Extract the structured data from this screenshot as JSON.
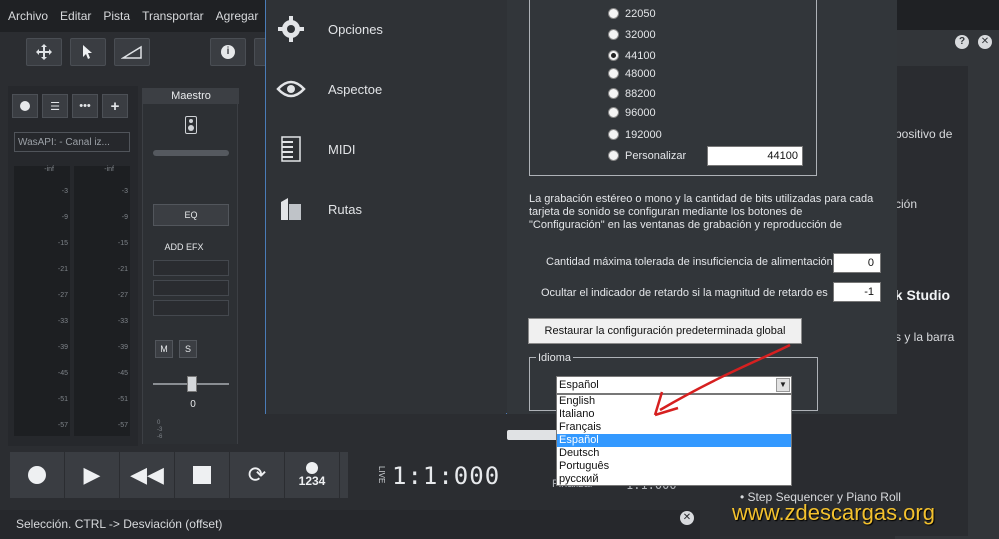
{
  "menubar": {
    "items": [
      "Archivo",
      "Editar",
      "Pista",
      "Transportar",
      "Agregar"
    ]
  },
  "toolbar": {
    "icons": [
      "move-icon",
      "pointer-icon",
      "envelope-icon",
      "info-icon"
    ]
  },
  "tracks": {
    "device": "WasAPI:  - Canal iz...",
    "meter_inf": "-inf",
    "ticks": [
      "-3",
      "-9",
      "-15",
      "-21",
      "-27",
      "-33",
      "-39",
      "-45",
      "-51",
      "-57"
    ]
  },
  "master": {
    "title": "Maestro",
    "eq_label": "EQ",
    "add_fx": "ADD EFX",
    "mute": "M",
    "solo": "S",
    "fader_value": "0",
    "mini_ticks": [
      "0",
      "-3",
      "-6"
    ]
  },
  "transport": {
    "live_label": "LIVE",
    "timecode": "1:1:000",
    "count_in": "1234",
    "finalizar_label": "Finalizar",
    "finalizar_value": "1:1:000"
  },
  "status": {
    "text": "Selección. CTRL -> Desviación (offset)"
  },
  "right_panel": {
    "line1": "positivo de",
    "line2": "ción",
    "heading": "ck Studio",
    "line3": "s y la barra",
    "bullet": "Step Sequencer y Piano Roll"
  },
  "watermark": "www.zdescargas.org",
  "dialog": {
    "nav": [
      {
        "label": "Opciones",
        "icon": "gear-icon"
      },
      {
        "label": "Aspectoe",
        "icon": "eye-icon"
      },
      {
        "label": "MIDI",
        "icon": "piano-icon"
      },
      {
        "label": "Rutas",
        "icon": "folder-icon"
      }
    ],
    "sample_rates": [
      "22050",
      "32000",
      "44100",
      "48000",
      "88200",
      "96000",
      "192000",
      "Personalizar"
    ],
    "selected_rate": "44100",
    "custom_rate": "44100",
    "info_text": "La grabación estéreo o mono y la cantidad de bits utilizadas para cada tarjeta de sonido se configuran mediante los botones de \"Configuración\" en las ventanas de grabación y reproducción de",
    "underrun_label": "Cantidad máxima tolerada de insuficiencia de alimentación",
    "underrun_value": "0",
    "latency_label": "Ocultar el indicador de retardo si la magnitud de retardo es",
    "latency_value": "-1",
    "restore_button": "Restaurar la configuración predeterminada global",
    "language_group": "Idioma",
    "language_selected": "Español",
    "languages": [
      "English",
      "Italiano",
      "Français",
      "Español",
      "Deutsch",
      "Português",
      "русский"
    ]
  }
}
